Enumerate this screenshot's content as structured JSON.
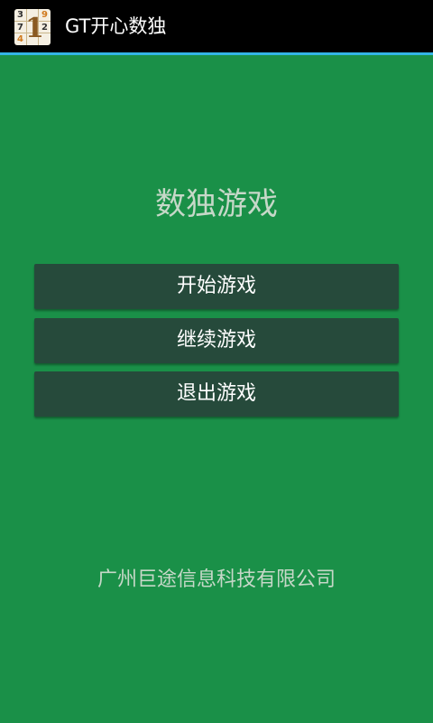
{
  "app": {
    "title": "GT开心数独",
    "icon": "sudoku-app-icon",
    "icon_digits": [
      "3",
      "9",
      "7",
      "2",
      "4"
    ],
    "icon_big_digit": "1"
  },
  "main": {
    "heading": "数独游戏",
    "buttons": {
      "start": "开始游戏",
      "continue": "继续游戏",
      "exit": "退出游戏"
    }
  },
  "footer": {
    "company": "广州巨途信息科技有限公司"
  },
  "colors": {
    "background": "#1a9048",
    "button": "#264a3b",
    "titlebar": "#000000",
    "accent": "#33b5e5",
    "muted_text": "#c6d8c8"
  }
}
